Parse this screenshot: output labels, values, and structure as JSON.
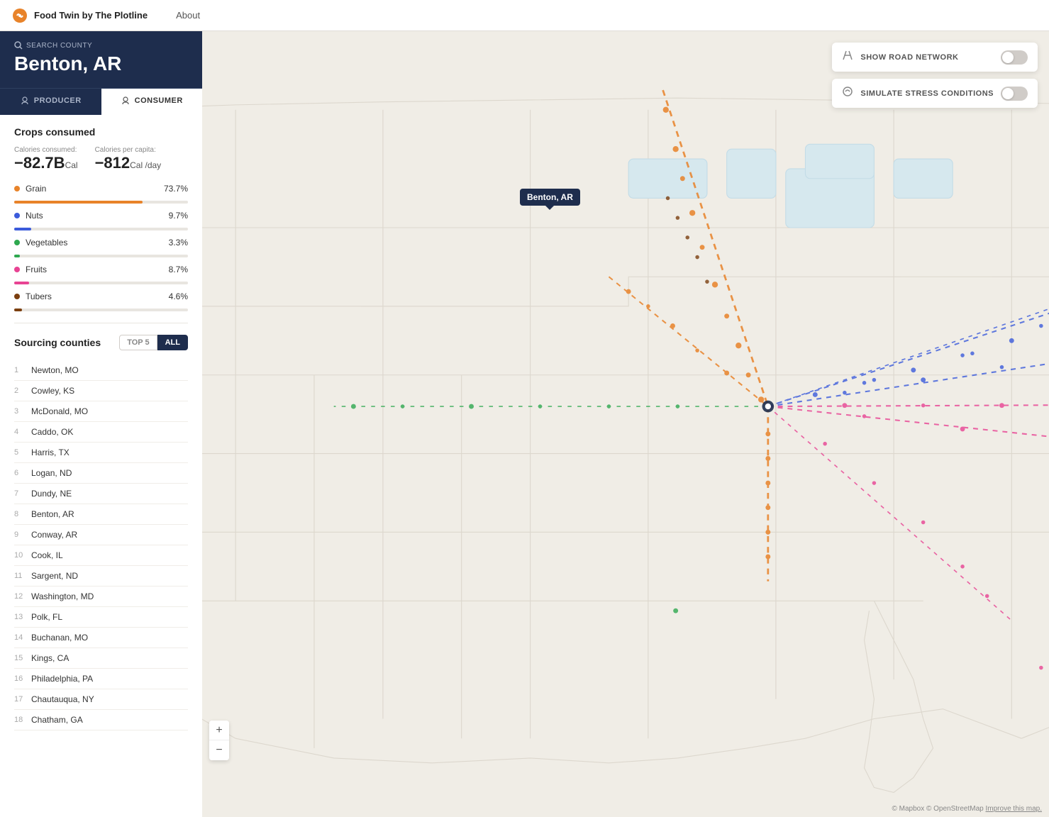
{
  "nav": {
    "logo_text": "Food Twin by The Plotline",
    "about_label": "About"
  },
  "county_header": {
    "search_label": "SEARCH COUNTY",
    "county_name": "Benton, AR"
  },
  "tabs": [
    {
      "id": "producer",
      "label": "PRODUCER",
      "active": false
    },
    {
      "id": "consumer",
      "label": "CONSUMER",
      "active": true
    }
  ],
  "crops": {
    "section_title": "Crops consumed",
    "calories_consumed_label": "Calories consumed:",
    "calories_consumed_value": "−82.7B",
    "calories_consumed_unit": "Cal",
    "calories_per_capita_label": "Calories per capita:",
    "calories_per_capita_value": "−812",
    "calories_per_capita_unit": "Cal /day",
    "items": [
      {
        "name": "Grain",
        "pct": 73.7,
        "pct_label": "73.7%",
        "color": "#e8832a"
      },
      {
        "name": "Nuts",
        "pct": 9.7,
        "pct_label": "9.7%",
        "color": "#3b5bdb"
      },
      {
        "name": "Vegetables",
        "pct": 3.3,
        "pct_label": "3.3%",
        "color": "#2ea84f"
      },
      {
        "name": "Fruits",
        "pct": 8.7,
        "pct_label": "8.7%",
        "color": "#e84393"
      },
      {
        "name": "Tubers",
        "pct": 4.6,
        "pct_label": "4.6%",
        "color": "#7b3f10"
      }
    ]
  },
  "sourcing": {
    "title": "Sourcing counties",
    "filter_top5": "TOP 5",
    "filter_all": "ALL",
    "active_filter": "ALL",
    "counties": [
      {
        "num": 1,
        "name": "Newton, MO"
      },
      {
        "num": 2,
        "name": "Cowley, KS"
      },
      {
        "num": 3,
        "name": "McDonald, MO"
      },
      {
        "num": 4,
        "name": "Caddo, OK"
      },
      {
        "num": 5,
        "name": "Harris, TX"
      },
      {
        "num": 6,
        "name": "Logan, ND"
      },
      {
        "num": 7,
        "name": "Dundy, NE"
      },
      {
        "num": 8,
        "name": "Benton, AR"
      },
      {
        "num": 9,
        "name": "Conway, AR"
      },
      {
        "num": 10,
        "name": "Cook, IL"
      },
      {
        "num": 11,
        "name": "Sargent, ND"
      },
      {
        "num": 12,
        "name": "Washington, MD"
      },
      {
        "num": 13,
        "name": "Polk, FL"
      },
      {
        "num": 14,
        "name": "Buchanan, MO"
      },
      {
        "num": 15,
        "name": "Kings, CA"
      },
      {
        "num": 16,
        "name": "Philadelphia, PA"
      },
      {
        "num": 17,
        "name": "Chautauqua, NY"
      },
      {
        "num": 18,
        "name": "Chatham, GA"
      }
    ]
  },
  "controls": {
    "road_network_label": "SHOW ROAD NETWORK",
    "stress_label": "SIMULATE STRESS CONDITIONS",
    "road_network_on": false,
    "stress_on": false
  },
  "map": {
    "tooltip": "Benton, AR",
    "attribution": "© Mapbox © OpenStreetMap",
    "improve_label": "Improve this map."
  }
}
